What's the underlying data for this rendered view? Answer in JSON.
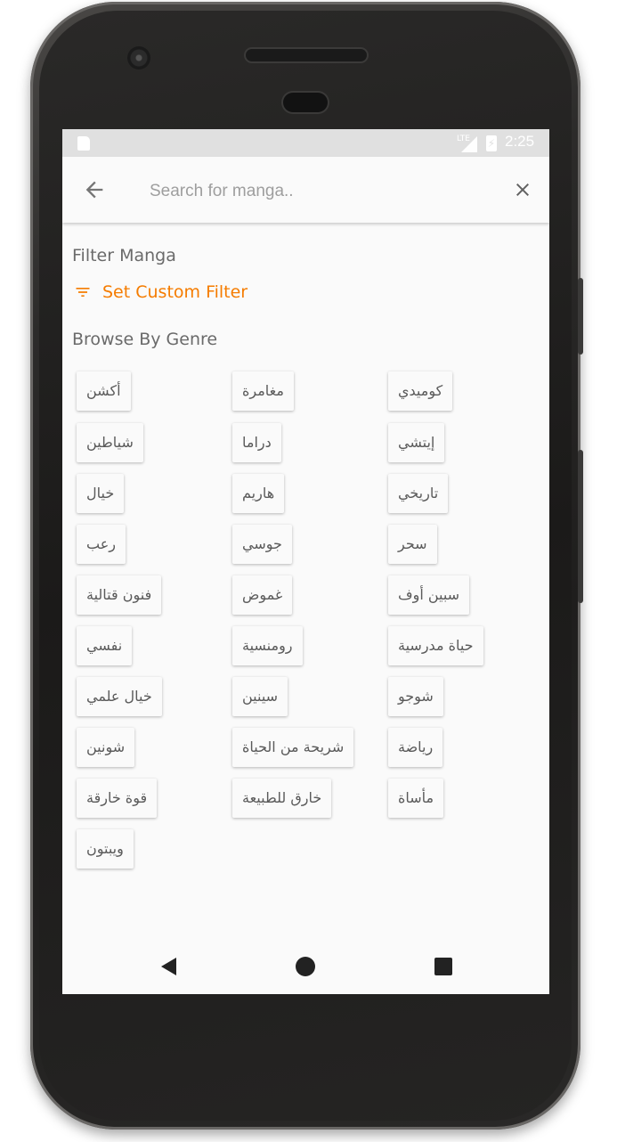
{
  "status_bar": {
    "network": "LTE",
    "time": "2:25"
  },
  "toolbar": {
    "search_placeholder": "Search for manga.."
  },
  "filter": {
    "title": "Filter Manga",
    "custom_filter_label": "Set Custom Filter"
  },
  "browse": {
    "title": "Browse By Genre",
    "genres": [
      "أكشن",
      "مغامرة",
      "كوميدي",
      "شياطين",
      "دراما",
      "إيتشي",
      "خيال",
      "هاريم",
      "تاريخي",
      "رعب",
      "جوسي",
      "سحر",
      "فنون قتالية",
      "غموض",
      "سبين أوف",
      "نفسي",
      "رومنسية",
      "حياة مدرسية",
      "خيال علمي",
      "سينين",
      "شوجو",
      "شونين",
      "شريحة من الحياة",
      "رياضة",
      "قوة خارقة",
      "خارق للطبيعة",
      "مأساة",
      "ويبتون"
    ]
  },
  "colors": {
    "accent": "#f57c00",
    "status_bar": "#e0e0e0",
    "background": "#fafafa"
  },
  "icons": {
    "back": "arrow-left-icon",
    "close": "close-icon",
    "filter": "filter-list-icon",
    "nav_back": "triangle-back-icon",
    "nav_home": "circle-home-icon",
    "nav_recents": "square-recents-icon"
  }
}
